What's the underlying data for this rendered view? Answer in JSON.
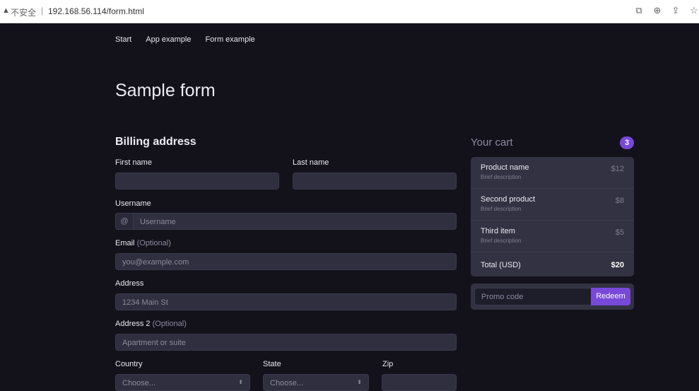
{
  "browser": {
    "warning_glyph": "▲",
    "insecure_label": "不安全",
    "separator": "|",
    "url": "192.168.56.114/form.html",
    "actions": [
      "⧉",
      "⊕",
      "⇪",
      "☆"
    ]
  },
  "nav": {
    "items": [
      "Start",
      "App example",
      "Form example"
    ]
  },
  "page": {
    "title": "Sample form"
  },
  "billing": {
    "title": "Billing address",
    "first_name_label": "First name",
    "last_name_label": "Last name",
    "username_label": "Username",
    "username_addon": "@",
    "username_placeholder": "Username",
    "email_label": "Email",
    "email_optional": "(Optional)",
    "email_placeholder": "you@example.com",
    "address_label": "Address",
    "address_placeholder": "1234 Main St",
    "address2_label": "Address 2",
    "address2_optional": "(Optional)",
    "address2_placeholder": "Apartment or suite",
    "country_label": "Country",
    "country_value": "Choose...",
    "state_label": "State",
    "state_value": "Choose...",
    "zip_label": "Zip",
    "select_chevron": "⬍"
  },
  "cart": {
    "title": "Your cart",
    "count": "3",
    "items": [
      {
        "name": "Product name",
        "desc": "Brief description",
        "price": "$12"
      },
      {
        "name": "Second product",
        "desc": "Brief description",
        "price": "$8"
      },
      {
        "name": "Third item",
        "desc": "Brief description",
        "price": "$5"
      }
    ],
    "total_label": "Total (USD)",
    "total_value": "$20",
    "promo_placeholder": "Promo code",
    "redeem_label": "Redeem"
  },
  "colors": {
    "background": "#13121b",
    "accent": "#7848d8",
    "input_bg": "#302f3f"
  }
}
